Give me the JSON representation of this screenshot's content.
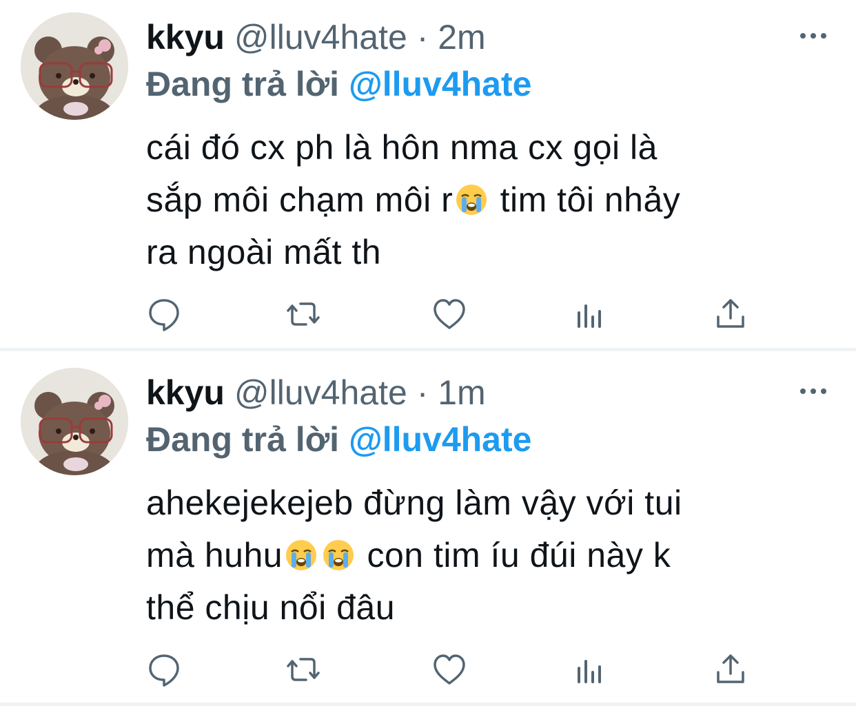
{
  "tweets": [
    {
      "name": "kkyu",
      "handle": "@lluv4hate",
      "separator": "·",
      "time": "2m",
      "replying_prefix": "Đang trả lời",
      "replying_handle": "@lluv4hate",
      "text_lines": [
        "cái đó cx ph là hôn nma cx gọi là",
        "sắp môi chạm môi r",
        " tim tôi nhảy",
        "ra ngoài mất th"
      ],
      "emoji": "loudly-crying-face"
    },
    {
      "name": "kkyu",
      "handle": "@lluv4hate",
      "separator": "·",
      "time": "1m",
      "replying_prefix": "Đang trả lời",
      "replying_handle": "@lluv4hate",
      "text_lines": [
        "ahekejekejeb đừng làm vậy với tui",
        "mà huhu",
        " con tim íu đúi này k",
        "thể chịu nổi đâu"
      ],
      "emoji": "loudly-crying-face"
    }
  ],
  "icons": {
    "more": "more-horizontal-icon",
    "reply": "reply-icon",
    "retweet": "retweet-icon",
    "like": "heart-icon",
    "views": "views-icon",
    "share": "share-icon"
  },
  "colors": {
    "text": "#0f1419",
    "secondary": "#536471",
    "accent": "#1d9bf0",
    "divider": "#eff3f4"
  }
}
